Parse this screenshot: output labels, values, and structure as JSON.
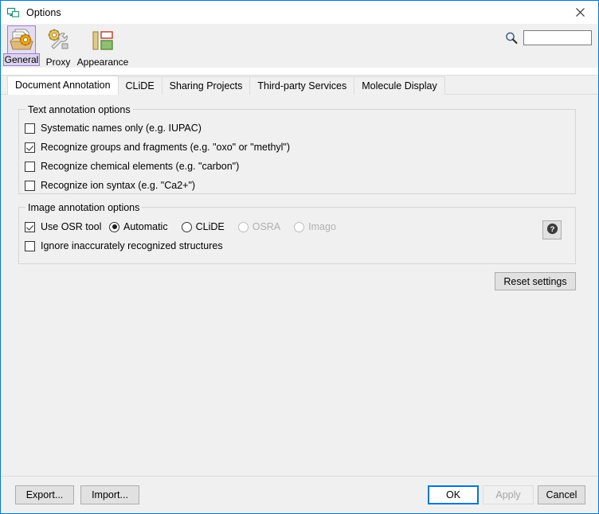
{
  "window": {
    "title": "Options",
    "icon": "options-window-icon",
    "close_label": "✕",
    "accent_color": "#0078d7"
  },
  "toolbar": {
    "items": [
      {
        "label": "General",
        "icon": "general-folder-gear-icon",
        "selected": true
      },
      {
        "label": "Proxy",
        "icon": "proxy-gear-wrench-icon",
        "selected": false
      },
      {
        "label": "Appearance",
        "icon": "appearance-layout-icon",
        "selected": false
      }
    ],
    "search": {
      "icon": "search-icon",
      "value": "",
      "placeholder": ""
    }
  },
  "tabs": [
    {
      "label": "Document Annotation",
      "active": true
    },
    {
      "label": "CLiDE",
      "active": false
    },
    {
      "label": "Sharing Projects",
      "active": false
    },
    {
      "label": "Third-party Services",
      "active": false
    },
    {
      "label": "Molecule Display",
      "active": false
    }
  ],
  "text_annotation": {
    "title": "Text annotation options",
    "options": [
      {
        "label": "Systematic names only (e.g. IUPAC)",
        "checked": false,
        "disabled": false
      },
      {
        "label": "Recognize groups and fragments (e.g. \"oxo\" or \"methyl\")",
        "checked": true,
        "disabled": false
      },
      {
        "label": "Recognize chemical elements (e.g. \"carbon\")",
        "checked": false,
        "disabled": false
      },
      {
        "label": "Recognize ion syntax (e.g. \"Ca2+\")",
        "checked": false,
        "disabled": false
      }
    ]
  },
  "image_annotation": {
    "title": "Image annotation options",
    "use_osr": {
      "label": "Use OSR tool",
      "checked": true
    },
    "osr_tools": [
      {
        "label": "Automatic",
        "selected": true,
        "disabled": false
      },
      {
        "label": "CLiDE",
        "selected": false,
        "disabled": false
      },
      {
        "label": "OSRA",
        "selected": false,
        "disabled": true
      },
      {
        "label": "Imago",
        "selected": false,
        "disabled": true
      }
    ],
    "ignore_inaccurate": {
      "label": "Ignore inaccurately recognized structures",
      "checked": false
    },
    "help": {
      "icon": "help-question-icon",
      "label": "?"
    }
  },
  "reset": {
    "label": "Reset settings"
  },
  "footer": {
    "export_label": "Export...",
    "import_label": "Import...",
    "ok_label": "OK",
    "apply_label": "Apply",
    "apply_disabled": true,
    "cancel_label": "Cancel"
  }
}
